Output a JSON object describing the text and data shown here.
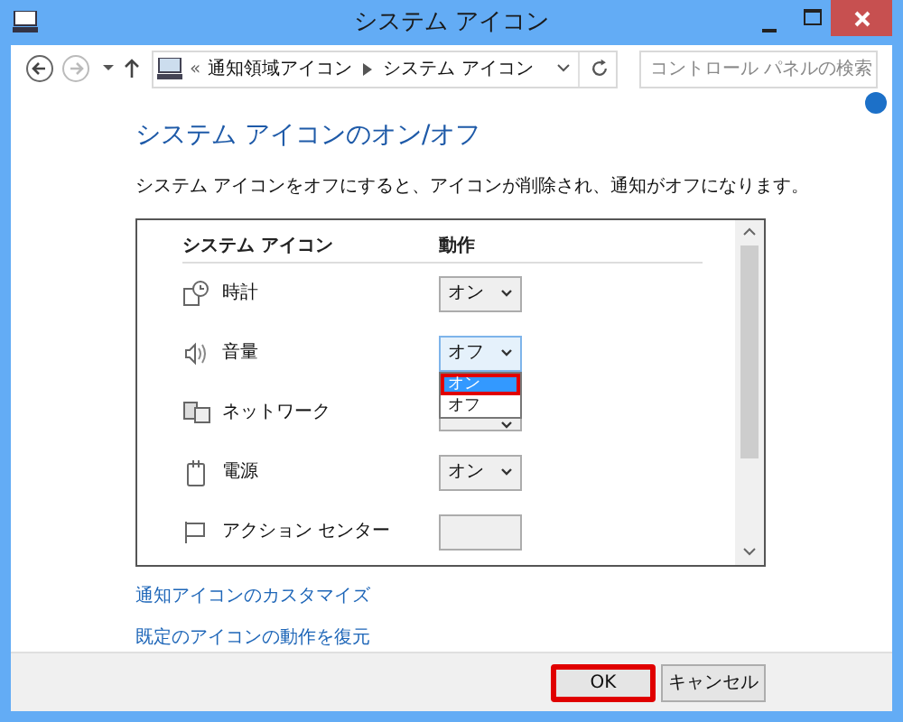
{
  "window": {
    "title": "システム アイコン"
  },
  "nav": {
    "overflow": "«",
    "breadcrumb": [
      {
        "label": "通知領域アイコン"
      },
      {
        "label": "システム アイコン"
      }
    ],
    "search": {
      "placeholder": "コントロール パネルの検索"
    }
  },
  "heading": "システム アイコンのオン/オフ",
  "description": "システム アイコンをオフにすると、アイコンが削除され、通知がオフになります。",
  "table": {
    "columns": [
      "システム アイコン",
      "動作"
    ],
    "rows": [
      {
        "kind": "clock",
        "name": "時計",
        "value": "オン",
        "open": false
      },
      {
        "kind": "volume",
        "name": "音量",
        "value": "オフ",
        "open": true
      },
      {
        "kind": "network",
        "name": "ネットワーク",
        "open": false
      },
      {
        "kind": "power",
        "name": "電源",
        "value": "オン",
        "open": false
      },
      {
        "kind": "flag",
        "name": "アクション センター",
        "open": false
      }
    ]
  },
  "dropdown_options": [
    {
      "label": "オン",
      "selected": true,
      "highlighted": true
    },
    {
      "label": "オフ",
      "selected": false,
      "highlighted": false
    }
  ],
  "links": [
    "通知アイコンのカスタマイズ",
    "既定のアイコンの動作を復元"
  ],
  "buttons": [
    {
      "label": "OK",
      "highlighted": true
    },
    {
      "label": "キャンセル",
      "highlighted": false
    }
  ]
}
